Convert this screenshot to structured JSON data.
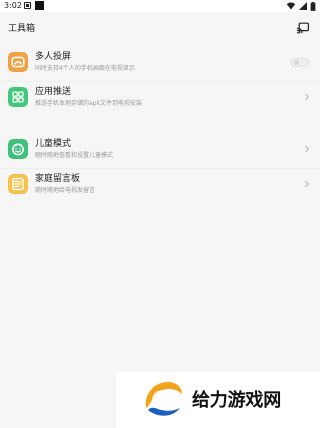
{
  "status_bar": {
    "time": "3:02",
    "icons": {
      "notification": "notification-icon",
      "square": "square-icon",
      "wifi": "wifi-icon",
      "signal": "signal-icon",
      "battery": "battery-icon"
    }
  },
  "app_bar": {
    "title": "工具箱",
    "right_icon": "cast-icon"
  },
  "sections": {
    "section1": {
      "items": [
        {
          "title": "多人投屏",
          "description": "同时支持4个人的手机画面在电视显示",
          "control": "toggle",
          "toggle_on": false,
          "icon": "multi-cast-icon",
          "accent": "#f1a043"
        },
        {
          "title": "应用推送",
          "description": "推送手机本地存储的apk文件到电视安装",
          "control": "chevron",
          "icon": "app-push-icon",
          "accent": "#42c77b"
        }
      ]
    },
    "section2": {
      "items": [
        {
          "title": "儿童模式",
          "description": "随时随地查看和设置儿童模式",
          "control": "chevron",
          "icon": "kids-mode-icon",
          "accent": "#3ec17d"
        },
        {
          "title": "家庭留言板",
          "description": "随时随地给电视发留言",
          "control": "chevron",
          "icon": "message-board-icon",
          "accent": "#f4c24d"
        }
      ]
    }
  },
  "watermark": {
    "text": "给力游戏网",
    "logo_icon": "watermark-logo-icon"
  }
}
